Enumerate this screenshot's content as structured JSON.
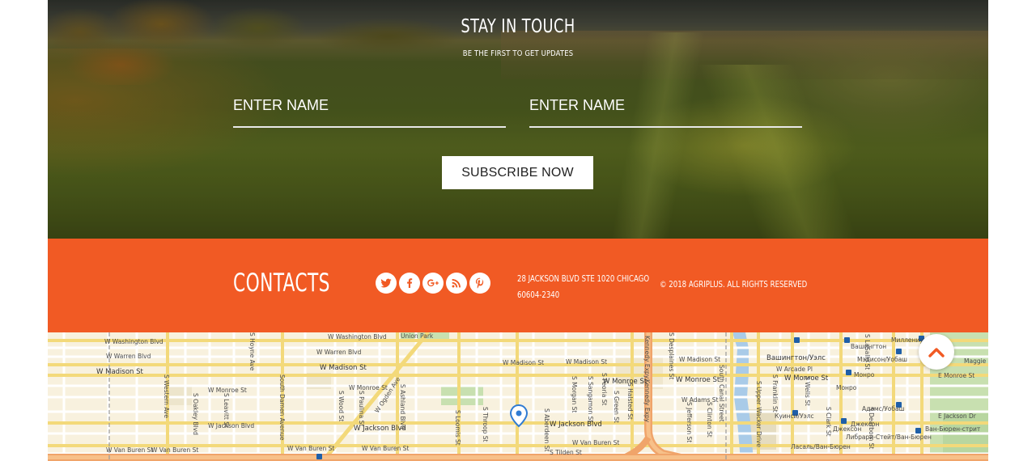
{
  "subscribe": {
    "title": "STAY IN TOUCH",
    "subtitle": "BE THE FIRST TO GET UPDATES",
    "field1_placeholder": "ENTER NAME",
    "field2_placeholder": "ENTER NAME",
    "button_label": "SUBSCRIBE NOW"
  },
  "contacts": {
    "title": "CONTACTS",
    "socials": [
      {
        "icon": "twitter-icon",
        "color": "#f15a24"
      },
      {
        "icon": "facebook-icon",
        "color": "#f15a24"
      },
      {
        "icon": "google-plus-icon",
        "color": "#f15a24"
      },
      {
        "icon": "rss-icon",
        "color": "#f15a24"
      },
      {
        "icon": "pinterest-icon",
        "color": "#f15a24"
      }
    ],
    "address_line1": "28 JACKSON BLVD STE 1020 CHICAGO",
    "address_line2": "60604-2340",
    "copyright": "© 2018 AGRIPLUS. ALL RIGHTS RESERVED",
    "bar_color": "#f15a24"
  },
  "map": {
    "labels": {
      "w_washington_1": "W Washington Blvd",
      "w_washington_2": "W Washington Blvd",
      "union_park": "Union Park",
      "w_warren_1": "W Warren Blvd",
      "w_warren_2": "W Warren Blvd",
      "w_madison_1": "W Madison St",
      "w_madison_2": "W Madison St",
      "w_madison_3": "W Madison St",
      "w_madison_4": "W Madison St",
      "w_madison_5": "W Madison St",
      "w_monroe_1": "W Monroe St",
      "w_monroe_2": "W Monroe St",
      "w_monroe_3": "W Monroe St",
      "w_monroe_4": "W Monroe St",
      "w_monroe_5": "W Monroe St",
      "w_adams_1": "W Adams St",
      "w_adams_2": "W Arcade Pl",
      "w_jackson_1": "W Jackson Blvd",
      "w_jackson_2": "W Jackson Blvd",
      "w_jackson_3": "W Jackson Blvd",
      "w_van_buren_1": "W Van Buren St",
      "w_van_buren_2": "W Van Buren St",
      "w_van_buren_3": "W Van Buren St",
      "w_van_buren_4": "W Van Buren St",
      "w_van_buren_5": "W Van Buren St",
      "s_western": "S Western Ave",
      "s_oakley": "S Oakley Blvd",
      "s_leavitt": "S Leavitt St",
      "s_hoyne": "S Hoyne Ave",
      "s_damen": "South Damen Avenue",
      "s_wood": "S Wood St",
      "s_paulina": "S Paulina St",
      "w_ogden": "W Ogden Ave",
      "s_ashland": "S Ashland Blvd",
      "s_loomis": "S Loomis St",
      "s_throop": "S Throop St",
      "s_aberdeen": "S Aberdeen St",
      "s_morgan": "S Morgan St",
      "s_sangamon": "S Sangamon St",
      "s_peoria": "S Peoria St",
      "s_green": "S Green St",
      "s_halsted": "S Halsted St",
      "kennedy_1": "Kennedy Expy",
      "kennedy_2": "Kennedy Expy",
      "s_desplaines": "S Desplaines St",
      "s_jefferson": "S Jefferson St",
      "s_clinton": "S Clinton St",
      "s_canal": "South Canal Street",
      "s_wacker": "S Upper Wacker Drive",
      "s_franklin": "S Franklin St",
      "s_wells": "S Wells St",
      "s_lasalle": "S LaSalle St",
      "s_clark": "S Clark St",
      "s_dearborn": "S Dearborn St",
      "w_tilden": "S Tilden St",
      "w_quincy": "W Quincy St",
      "e_monroe": "E Monroe St",
      "e_jackson": "E Jackson Dr",
      "maggie": "Maggie Daley Park",
      "washington_wells": "Вашингтон/Уэлс",
      "washington": "Вашингтон",
      "millennium": "Миллениум",
      "madison_wabash": "Мэдисон/Уобаш",
      "monroe": "Монро",
      "monroe_2": "Монро",
      "adams_wabash": "Адамс/Уобаш",
      "quincy_wells": "Куинси/Уэлс",
      "jackson": "Джексон",
      "jackson_2": "Джексон",
      "library": "Либрари-Стейт/Ван-Бюрен",
      "van_buren_street": "Ван-Бюрен-стрит",
      "lasalle_van_buren": "Ласаль/Ван-Бюрен"
    }
  },
  "back_to_top": {
    "icon": "chevron-up-icon",
    "color": "#f15a24"
  }
}
